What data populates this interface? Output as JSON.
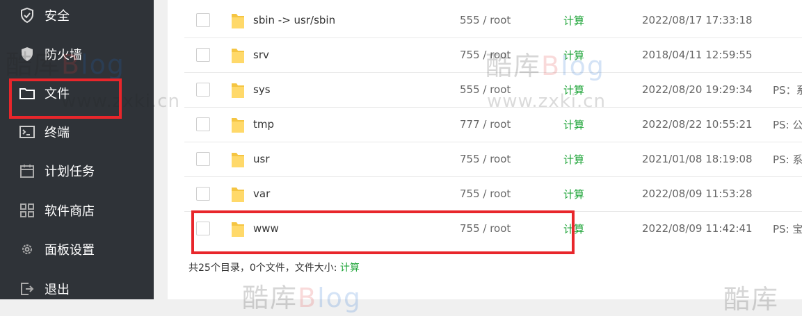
{
  "sidebar": {
    "items": [
      {
        "label": "安全",
        "icon": "shield-check-icon"
      },
      {
        "label": "防火墙",
        "icon": "firewall-shield-icon"
      },
      {
        "label": "文件",
        "icon": "folder-icon"
      },
      {
        "label": "终端",
        "icon": "terminal-icon"
      },
      {
        "label": "计划任务",
        "icon": "calendar-icon"
      },
      {
        "label": "软件商店",
        "icon": "grid-apps-icon"
      },
      {
        "label": "面板设置",
        "icon": "gear-icon"
      },
      {
        "label": "退出",
        "icon": "logout-icon"
      }
    ]
  },
  "files": [
    {
      "name": "sbin -> usr/sbin",
      "perm": "555 / root",
      "size": "计算",
      "time": "2022/08/17 17:33:18",
      "ps": ""
    },
    {
      "name": "srv",
      "perm": "755 / root",
      "size": "计算",
      "time": "2018/04/11 12:59:55",
      "ps": ""
    },
    {
      "name": "sys",
      "perm": "555 / root",
      "size": "计算",
      "time": "2022/08/20 19:29:34",
      "ps": "PS：系"
    },
    {
      "name": "tmp",
      "perm": "777 / root",
      "size": "计算",
      "time": "2022/08/22 10:55:21",
      "ps": "PS: 公"
    },
    {
      "name": "usr",
      "perm": "755 / root",
      "size": "计算",
      "time": "2021/01/08 18:19:08",
      "ps": "PS: 系"
    },
    {
      "name": "var",
      "perm": "755 / root",
      "size": "计算",
      "time": "2022/08/09 11:53:28",
      "ps": ""
    },
    {
      "name": "www",
      "perm": "755 / root",
      "size": "计算",
      "time": "2022/08/09 11:42:41",
      "ps": "PS: 宝"
    }
  ],
  "summary": {
    "text": "共25个目录，0个文件，文件大小: ",
    "link": "计算"
  },
  "watermark": {
    "brand_cn": "酷库",
    "brand_b": "B",
    "brand_log": "log",
    "url": "www.zxki.cn"
  },
  "colors": {
    "sidebar_bg": "#2f3338",
    "accent_green": "#20a53a",
    "highlight_red": "#e8262b",
    "folder_yellow": "#f5c542"
  }
}
